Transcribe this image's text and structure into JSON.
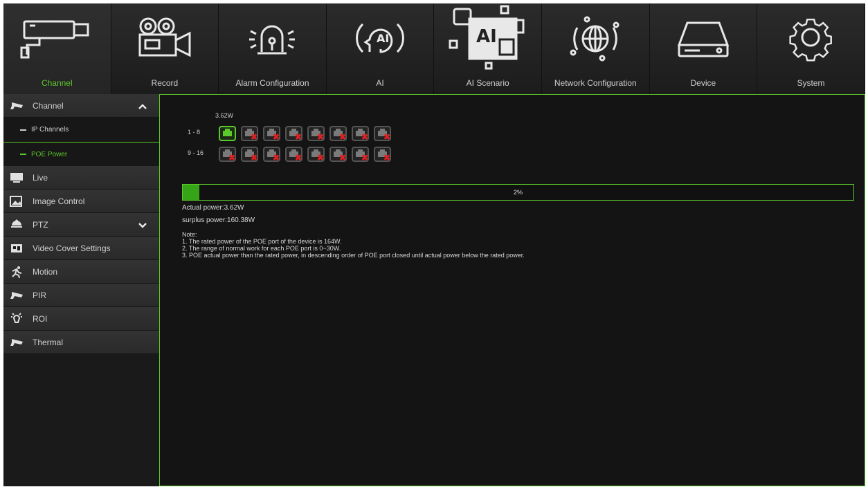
{
  "nav": {
    "items": [
      {
        "label": "Channel",
        "icon": "camera-icon",
        "active": true
      },
      {
        "label": "Record",
        "icon": "video-camera-icon"
      },
      {
        "label": "Alarm Configuration",
        "icon": "alarm-light-icon"
      },
      {
        "label": "AI",
        "icon": "ai-head-icon"
      },
      {
        "label": "AI Scenario",
        "icon": "ai-scenario-icon"
      },
      {
        "label": "Network Configuration",
        "icon": "globe-icon"
      },
      {
        "label": "Device",
        "icon": "hard-drive-icon"
      },
      {
        "label": "System",
        "icon": "gear-icon"
      }
    ]
  },
  "sidebar": {
    "channel": {
      "label": "Channel"
    },
    "sub": [
      {
        "label": "IP Channels"
      },
      {
        "label": "POE Power",
        "active": true
      }
    ],
    "groups": [
      {
        "label": "Live",
        "icon": "monitor-icon"
      },
      {
        "label": "Image Control",
        "icon": "image-icon"
      },
      {
        "label": "PTZ",
        "icon": "dome-camera-icon"
      },
      {
        "label": "Video Cover Settings",
        "icon": "video-cover-icon"
      },
      {
        "label": "Motion",
        "icon": "running-person-icon"
      },
      {
        "label": "PIR",
        "icon": "camera-icon"
      },
      {
        "label": "ROI",
        "icon": "bulb-icon"
      },
      {
        "label": "Thermal",
        "icon": "camera-icon"
      }
    ]
  },
  "poe": {
    "port_power": "3.62W",
    "rows": [
      {
        "label": "1 - 8",
        "ports": [
          "ok",
          "off",
          "off",
          "off",
          "off",
          "off",
          "off",
          "off"
        ]
      },
      {
        "label": "9 - 16",
        "ports": [
          "off",
          "off",
          "off",
          "off",
          "off",
          "off",
          "off",
          "off"
        ]
      }
    ],
    "usage_percent": 2,
    "usage_text": "2%",
    "actual_power": "Actual power:3.62W",
    "surplus_power": "surplus power:160.38W",
    "note_title": "Note:",
    "notes": [
      "1. The rated power of the POE port of the device is 164W.",
      "2. The range of normal work for each POE port is 0~30W.",
      "3. POE actual power than the rated power, in descending order of POE port closed until actual power below the rated power."
    ]
  },
  "colors": {
    "accent": "#5cc92a",
    "error": "#e02020",
    "background": "#141414"
  }
}
